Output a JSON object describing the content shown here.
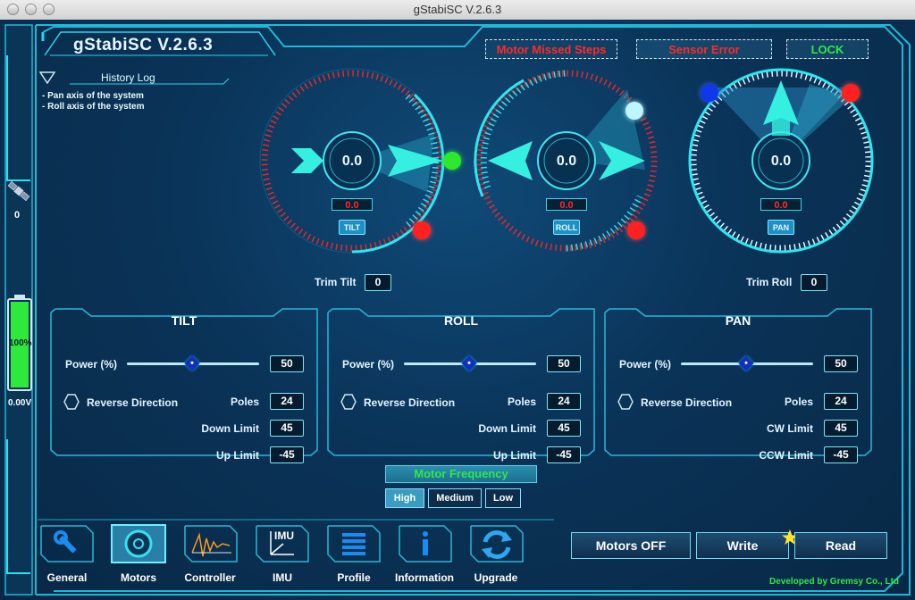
{
  "window": {
    "title": "gStabiSC V.2.6.3"
  },
  "app": {
    "name": "gStabiSC V.2.6.3"
  },
  "status": {
    "motor_missed": "Motor Missed Steps",
    "sensor_error": "Sensor Error",
    "lock": "LOCK"
  },
  "history": {
    "title": "History Log",
    "lines": [
      "- Pan axis of the system",
      "- Roll axis of the system"
    ]
  },
  "sidebar": {
    "satellites": "0",
    "battery_percent": "100%",
    "voltage": "0.00V"
  },
  "dials": {
    "tilt": {
      "value": "0.0",
      "readout": "0.0",
      "tag": "TILT"
    },
    "roll": {
      "value": "0.0",
      "readout": "0.0",
      "tag": "ROLL"
    },
    "pan": {
      "value": "0.0",
      "readout": "0.0",
      "tag": "PAN"
    }
  },
  "trim": {
    "tilt_label": "Trim Tilt",
    "tilt_value": "0",
    "roll_label": "Trim Roll",
    "roll_value": "0"
  },
  "panels": {
    "tilt": {
      "title": "TILT",
      "power_label": "Power (%)",
      "power": "50",
      "power_level": 0.5,
      "reverse": "Reverse Direction",
      "poles_label": "Poles",
      "poles": "24",
      "limit1_label": "Down Limit",
      "limit1": "45",
      "limit2_label": "Up Limit",
      "limit2": "-45"
    },
    "roll": {
      "title": "ROLL",
      "power_label": "Power (%)",
      "power": "50",
      "power_level": 0.5,
      "reverse": "Reverse Direction",
      "poles_label": "Poles",
      "poles": "24",
      "limit1_label": "Down Limit",
      "limit1": "45",
      "limit2_label": "Up Limit",
      "limit2": "-45"
    },
    "pan": {
      "title": "PAN",
      "power_label": "Power (%)",
      "power": "50",
      "power_level": 0.5,
      "reverse": "Reverse Direction",
      "poles_label": "Poles",
      "poles": "24",
      "limit1_label": "CW Limit",
      "limit1": "45",
      "limit2_label": "CCW Limit",
      "limit2": "-45"
    }
  },
  "frequency": {
    "title": "Motor Frequency",
    "high": "High",
    "medium": "Medium",
    "low": "Low",
    "selected": "High"
  },
  "nav": {
    "general": "General",
    "motors": "Motors",
    "controller": "Controller",
    "imu": "IMU",
    "imu_icon_text": "IMU",
    "profile": "Profile",
    "information": "Information",
    "upgrade": "Upgrade"
  },
  "actions": {
    "motors_off": "Motors OFF",
    "write": "Write",
    "read": "Read"
  },
  "footer": "Developed by Gremsy Co., Ltd",
  "colors": {
    "accent": "#1ee8e0",
    "green": "#2fe84a",
    "red": "#ff2020",
    "bg": "#0a3358"
  }
}
